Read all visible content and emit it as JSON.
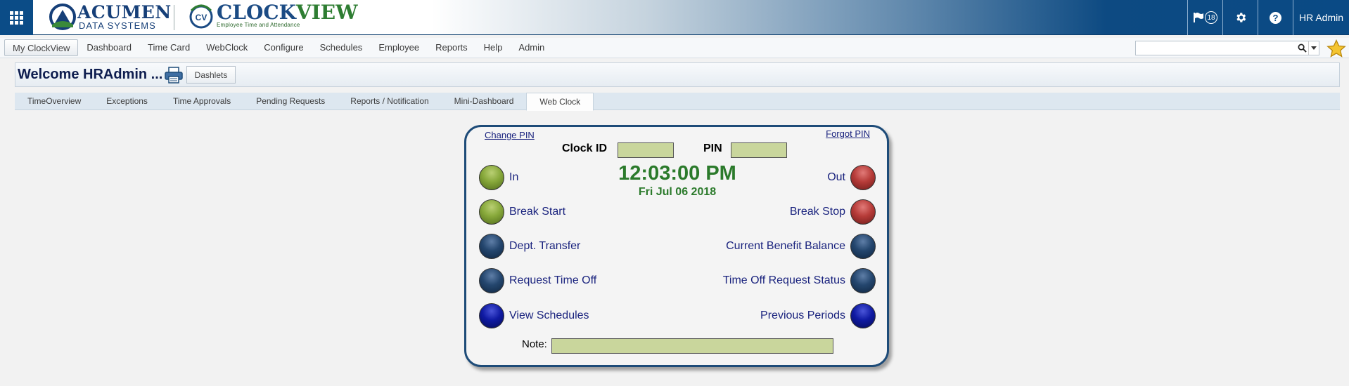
{
  "header": {
    "brand_acumen": "ACUMEN",
    "brand_acumen_sub": "DATA SYSTEMS",
    "brand_clock": "CLOCK",
    "brand_view": "VIEW",
    "brand_cv_mark": "CV",
    "brand_cv_sub": "Employee Time and Attendance",
    "flag_count": "18",
    "help_label": "?",
    "user": "HR Admin"
  },
  "menu": {
    "items": [
      "My ClockView",
      "Dashboard",
      "Time Card",
      "WebClock",
      "Configure",
      "Schedules",
      "Employee",
      "Reports",
      "Help",
      "Admin"
    ],
    "active": "My ClockView",
    "search_value": ""
  },
  "welcome": {
    "title": "Welcome HRAdmin ...",
    "dashlets_label": "Dashlets"
  },
  "tabs": {
    "items": [
      "TimeOverview",
      "Exceptions",
      "Time Approvals",
      "Pending Requests",
      "Reports / Notification",
      "Mini-Dashboard",
      "Web Clock"
    ],
    "active": "Web Clock"
  },
  "webclock": {
    "change_pin": "Change PIN",
    "forgot_pin": "Forgot PIN",
    "clock_id_label": "Clock ID",
    "clock_id_value": "",
    "pin_label": "PIN",
    "pin_value": "",
    "time": "12:03:00 PM",
    "date": "Fri Jul 06 2018",
    "note_label": "Note:",
    "note_value": "",
    "left_actions": [
      {
        "label": "In",
        "color": "green"
      },
      {
        "label": "Break Start",
        "color": "green"
      },
      {
        "label": "Dept. Transfer",
        "color": "navy"
      },
      {
        "label": "Request Time Off",
        "color": "navy"
      },
      {
        "label": "View Schedules",
        "color": "blue"
      }
    ],
    "right_actions": [
      {
        "label": "Out",
        "color": "red"
      },
      {
        "label": "Break Stop",
        "color": "red"
      },
      {
        "label": "Current Benefit Balance",
        "color": "navy"
      },
      {
        "label": "Time Off Request Status",
        "color": "navy"
      },
      {
        "label": "Previous Periods",
        "color": "blue"
      }
    ]
  },
  "colors": {
    "header_blue": "#0b4c87",
    "clock_green": "#2b7a2b",
    "link_navy": "#1a237e",
    "field_green": "#c9d69c",
    "panel_border": "#1d4b78"
  },
  "icons": {
    "apps": "apps-grid-icon",
    "flag": "flag-icon",
    "settings": "gear-icon",
    "help": "help-icon",
    "search": "search-icon",
    "favorite": "star-icon",
    "print": "print-icon"
  }
}
